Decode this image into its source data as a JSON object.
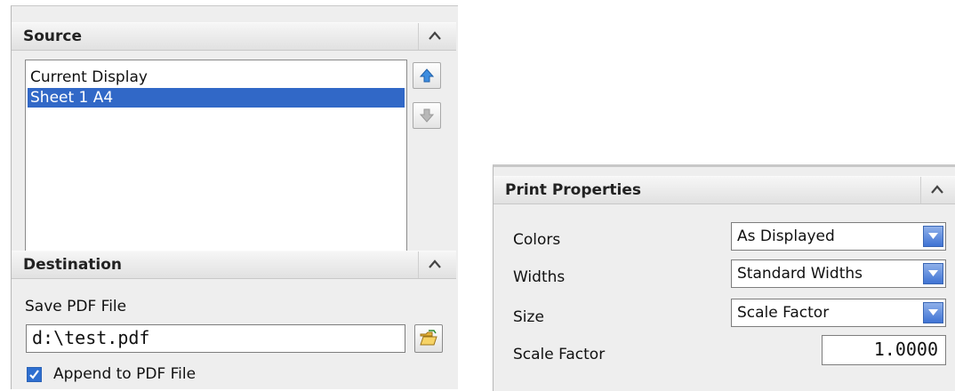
{
  "source": {
    "title": "Source",
    "items": [
      {
        "label": "Current Display",
        "selected": false
      },
      {
        "label": "Sheet 1  A4",
        "selected": true
      }
    ]
  },
  "destination": {
    "title": "Destination",
    "save_label": "Save PDF File",
    "file_path": "d:\\test.pdf",
    "append_label": "Append to PDF File",
    "append_checked": true
  },
  "print_properties": {
    "title": "Print Properties",
    "colors_label": "Colors",
    "colors_value": "As Displayed",
    "widths_label": "Widths",
    "widths_value": "Standard Widths",
    "size_label": "Size",
    "size_value": "Scale Factor",
    "scale_label": "Scale Factor",
    "scale_value": "1.0000"
  },
  "colors": {
    "selection": "#3168c7",
    "panel": "#eeeeee",
    "accent": "#2e6fd0"
  }
}
